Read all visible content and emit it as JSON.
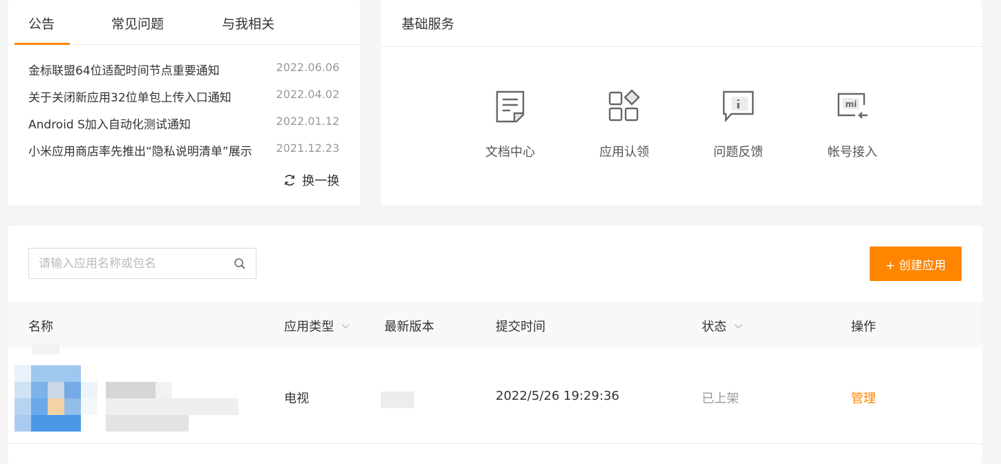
{
  "notices": {
    "tabs": [
      "公告",
      "常见问题",
      "与我相关"
    ],
    "items": [
      {
        "title": "金标联盟64位适配时间节点重要通知",
        "date": "2022.06.06"
      },
      {
        "title": "关于关闭新应用32位单包上传入口通知",
        "date": "2022.04.02"
      },
      {
        "title": "Android S加入自动化测试通知",
        "date": "2022.01.12"
      },
      {
        "title": "小米应用商店率先推出“隐私说明清单”展示",
        "date": "2021.12.23"
      }
    ],
    "refresh_label": "换一换"
  },
  "services": {
    "title": "基础服务",
    "items": [
      {
        "label": "文档中心",
        "icon": "document-icon"
      },
      {
        "label": "应用认领",
        "icon": "app-claim-icon"
      },
      {
        "label": "问题反馈",
        "icon": "feedback-icon"
      },
      {
        "label": "帐号接入",
        "icon": "account-access-icon"
      }
    ]
  },
  "app_list": {
    "search_placeholder": "请输入应用名称或包名",
    "create_label": "+ 创建应用",
    "columns": [
      "名称",
      "应用类型",
      "最新版本",
      "提交时间",
      "状态",
      "操作"
    ],
    "rows": [
      {
        "type": "电视",
        "submitted": "2022/5/26 19:29:36",
        "status": "已上架",
        "action": "管理"
      }
    ]
  },
  "colors": {
    "accent": "#ff8400",
    "muted": "#999999"
  }
}
